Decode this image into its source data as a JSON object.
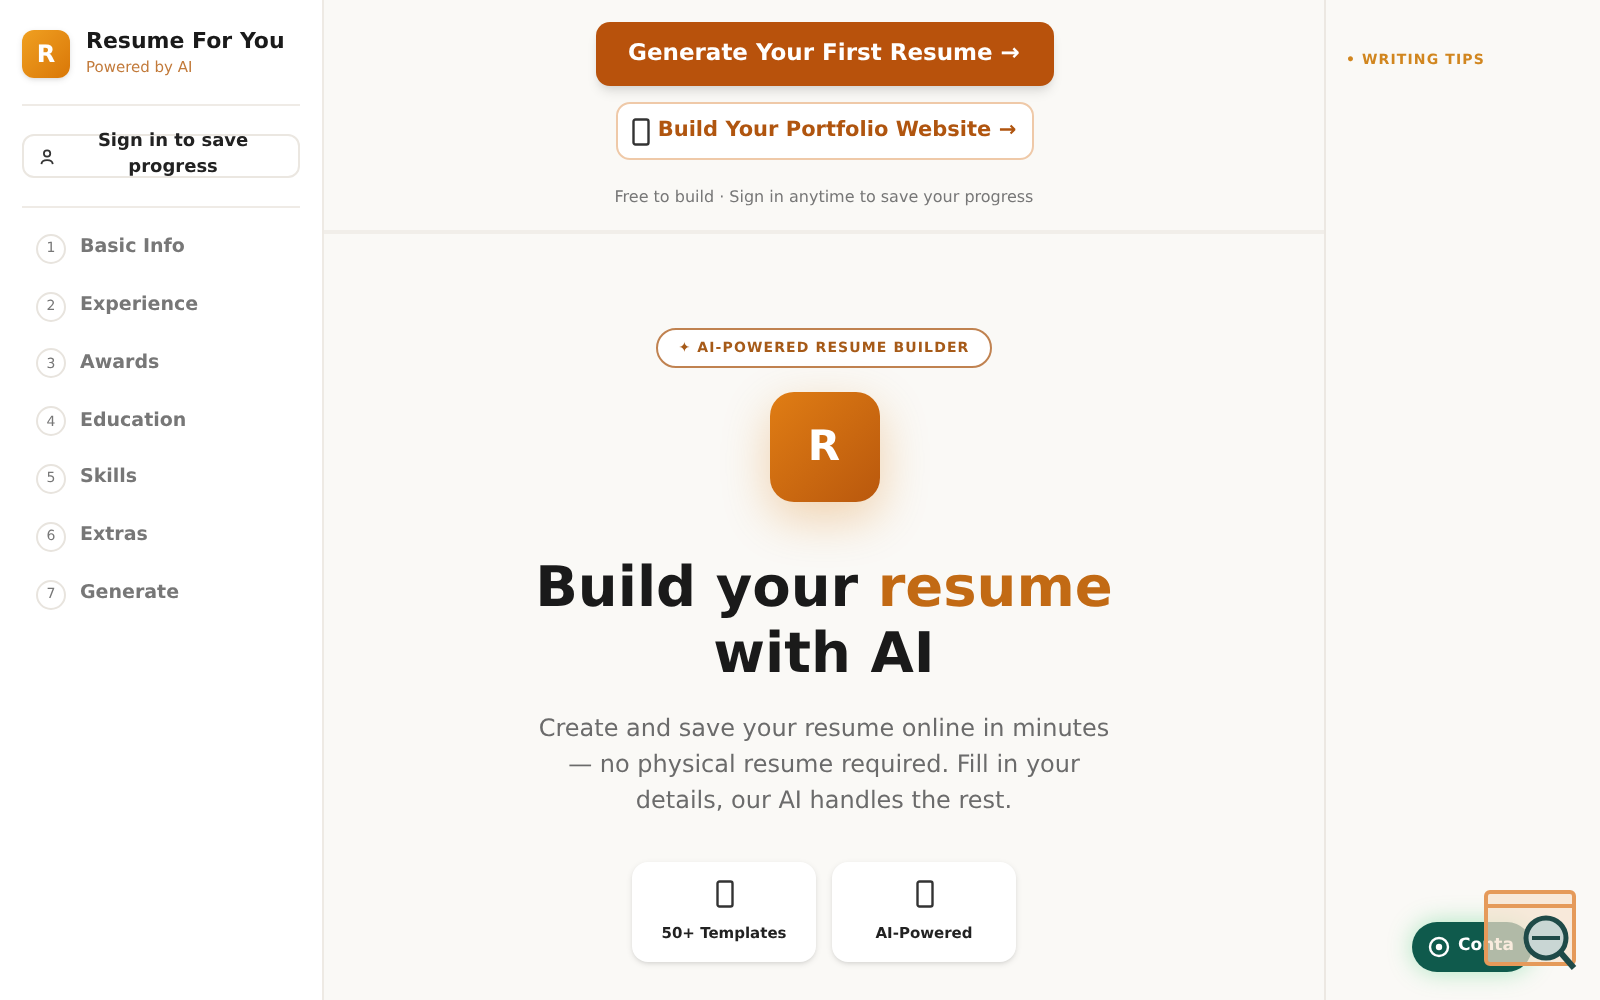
{
  "brand": {
    "logo": "R",
    "name": "Resume For You",
    "tagline": "Powered by AI"
  },
  "sign_in": {
    "label": "Sign in to save progress"
  },
  "steps": [
    {
      "number": "1",
      "label": "Basic Info"
    },
    {
      "number": "2",
      "label": "Experience"
    },
    {
      "number": "3",
      "label": "Awards"
    },
    {
      "number": "4",
      "label": "Education"
    },
    {
      "number": "5",
      "label": "Skills"
    },
    {
      "number": "6",
      "label": "Extras"
    },
    {
      "number": "7",
      "label": "Generate"
    }
  ],
  "cta": {
    "primary": "Generate Your First Resume →",
    "secondary": "Build Your Portfolio Website →",
    "note": "Free to build · Sign in anytime to save your progress"
  },
  "hero": {
    "badge": "✦ AI-POWERED RESUME BUILDER",
    "logo": "R",
    "title_start": "Build your ",
    "title_highlight": "resume",
    "title_end": "with AI",
    "description": "Create and save your resume online in minutes — no physical resume required. Fill in your details, our AI handles the rest."
  },
  "features": [
    {
      "label": "50+ Templates"
    },
    {
      "label": "AI-Powered"
    }
  ],
  "right_panel": {
    "heading": "• WRITING TIPS"
  },
  "contact": {
    "label": "Conta"
  }
}
